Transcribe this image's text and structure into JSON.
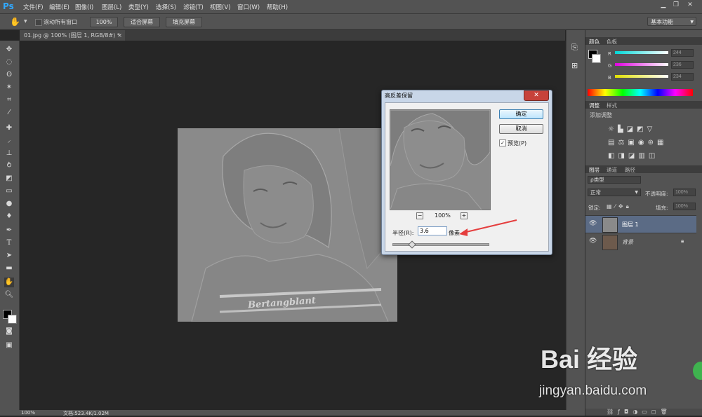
{
  "app": {
    "logo": "Ps"
  },
  "menu": [
    "文件(F)",
    "编辑(E)",
    "图像(I)",
    "图层(L)",
    "类型(Y)",
    "选择(S)",
    "滤镜(T)",
    "视图(V)",
    "窗口(W)",
    "帮助(H)"
  ],
  "options_bar": {
    "scroll_all": "滚动所有窗口",
    "zoom_100": "100%",
    "fit_screen": "适合屏幕",
    "fill_screen": "填充屏幕",
    "workspace": "基本功能"
  },
  "document_tab": {
    "title": "01.jpg @ 100% (图层 1, RGB/8#) *",
    "close": "×"
  },
  "status_bar": {
    "zoom": "100%",
    "doc_info": "文档:523.4K/1.02M"
  },
  "color_panel": {
    "tabs": [
      "颜色",
      "色板"
    ],
    "channels": [
      {
        "name": "R",
        "value": "244",
        "color": "#00d7d7"
      },
      {
        "name": "G",
        "value": "236",
        "color": "#e000e0"
      },
      {
        "name": "B",
        "value": "234",
        "color": "#e0e000"
      }
    ]
  },
  "adjustments_panel": {
    "tabs": [
      "调整",
      "样式"
    ],
    "title": "添加调整"
  },
  "layers_panel": {
    "tabs": [
      "图层",
      "通道",
      "路径"
    ],
    "kind_filter": "ρ类型",
    "blend_mode": "正常",
    "opacity_label": "不透明度:",
    "opacity_value": "100%",
    "lock_label": "锁定:",
    "fill_label": "填充:",
    "fill_value": "100%",
    "layers": [
      {
        "name": "图层 1",
        "selected": true
      },
      {
        "name": "背景",
        "selected": false
      }
    ]
  },
  "dialog": {
    "title": "高反差保留",
    "close": "✕",
    "ok": "确定",
    "cancel": "取消",
    "preview_label": "预览(P)",
    "zoom": "100%",
    "zoom_out": "−",
    "zoom_in": "+",
    "radius_label": "半径(R):",
    "radius_value": "3.6",
    "unit": "像素"
  },
  "photo_text": "Bertangblant",
  "watermark": {
    "text": "Bai 经验",
    "url": "jingyan.baidu.com"
  }
}
